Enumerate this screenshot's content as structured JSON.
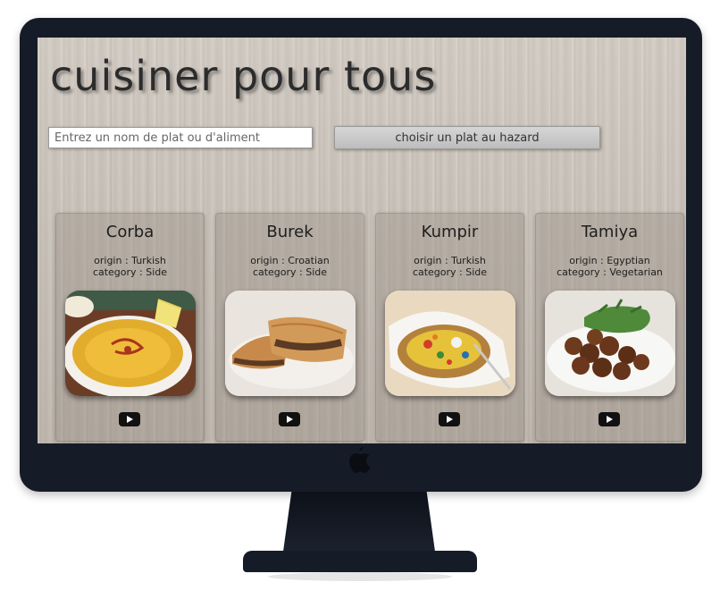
{
  "app": {
    "title": "cuisiner pour tous"
  },
  "search": {
    "placeholder": "Entrez un nom de plat ou d'aliment"
  },
  "random_button": {
    "label": "choisir un plat au hazard"
  },
  "dishes": [
    {
      "name": "Corba",
      "origin": "origin : Turkish",
      "category": "category : Side",
      "photo": "lentil-soup-photo"
    },
    {
      "name": "Burek",
      "origin": "origin : Croatian",
      "category": "category : Side",
      "photo": "meat-pastry-photo"
    },
    {
      "name": "Kumpir",
      "origin": "origin : Turkish",
      "category": "category : Side",
      "photo": "stuffed-potato-photo"
    },
    {
      "name": "Tamiya",
      "origin": "origin : Egyptian",
      "category": "category : Vegetarian",
      "photo": "falafel-photo"
    }
  ],
  "icons": {
    "video": "youtube-play-icon"
  },
  "colors": {
    "monitor_frame": "#161c27",
    "title_text": "#2c2c2c",
    "button_bg": "#c9c9c9"
  }
}
